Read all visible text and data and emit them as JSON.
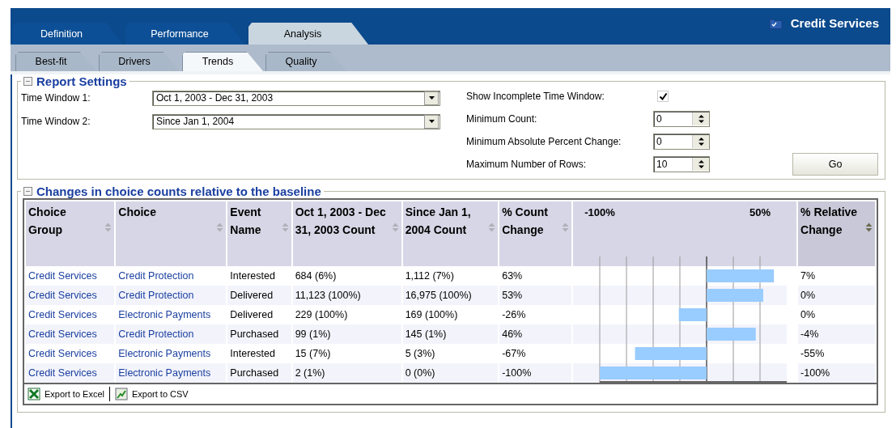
{
  "header": {
    "title": "Credit Services"
  },
  "tabs": [
    {
      "label": "Definition",
      "selected": false
    },
    {
      "label": "Performance",
      "selected": false
    },
    {
      "label": "Analysis",
      "selected": true
    }
  ],
  "subtabs": [
    {
      "label": "Best-fit",
      "selected": false
    },
    {
      "label": "Drivers",
      "selected": false
    },
    {
      "label": "Trends",
      "selected": true
    },
    {
      "label": "Quality",
      "selected": false
    }
  ],
  "report_settings": {
    "title": "Report Settings",
    "selects": [
      {
        "label": "Time Window 1:",
        "value": "Oct 1, 2003 - Dec 31, 2003"
      },
      {
        "label": "Time Window 2:",
        "value": "Since Jan 1, 2004"
      }
    ],
    "checkbox": {
      "label": "Show Incomplete Time Window:",
      "checked": true
    },
    "spinners": [
      {
        "label": "Minimum Count:",
        "value": "0"
      },
      {
        "label": "Minimum Absolute Percent Change:",
        "value": "0"
      },
      {
        "label": "Maximum Number of Rows:",
        "value": "10"
      }
    ],
    "go_button": "Go"
  },
  "changes": {
    "title": "Changes in choice counts relative to the baseline",
    "columns": [
      {
        "label": "Choice Group",
        "sorted": false
      },
      {
        "label": "Choice",
        "sorted": false
      },
      {
        "label": "Event Name",
        "sorted": false
      },
      {
        "label": "Oct 1, 2003 - Dec 31, 2003 Count",
        "sorted": false
      },
      {
        "label": "Since Jan 1, 2004 Count",
        "sorted": false
      },
      {
        "label": "% Count Change",
        "sorted": false
      },
      {
        "label": "% Relative Change",
        "sorted": true
      }
    ],
    "rows": [
      [
        "Credit Services",
        "Credit Protection",
        "Interested",
        "684 (6%)",
        "1,112 (7%)",
        "63%",
        "7%"
      ],
      [
        "Credit Services",
        "Credit Protection",
        "Delivered",
        "11,123 (100%)",
        "16,975 (100%)",
        "53%",
        "0%"
      ],
      [
        "Credit Services",
        "Electronic Payments",
        "Delivered",
        "229 (100%)",
        "169 (100%)",
        "-26%",
        "0%"
      ],
      [
        "Credit Services",
        "Credit Protection",
        "Purchased",
        "99 (1%)",
        "145 (1%)",
        "46%",
        "-4%"
      ],
      [
        "Credit Services",
        "Electronic Payments",
        "Interested",
        "15 (7%)",
        "5 (3%)",
        "-67%",
        "-55%"
      ],
      [
        "Credit Services",
        "Electronic Payments",
        "Purchased",
        "2 (1%)",
        "0 (0%)",
        "-100%",
        "-100%"
      ]
    ],
    "chart_data": {
      "type": "bar",
      "orientation": "horizontal",
      "xlim": [
        -100,
        75
      ],
      "xticks": [
        {
          "value": -100,
          "label": "-100%"
        },
        {
          "value": 50,
          "label": "50%"
        }
      ],
      "series": [
        {
          "color": "#99ccff",
          "values": [
            63,
            53,
            -26,
            46,
            -67,
            -100
          ]
        }
      ]
    },
    "exports": [
      "Export to Excel",
      "Export to CSV"
    ]
  }
}
